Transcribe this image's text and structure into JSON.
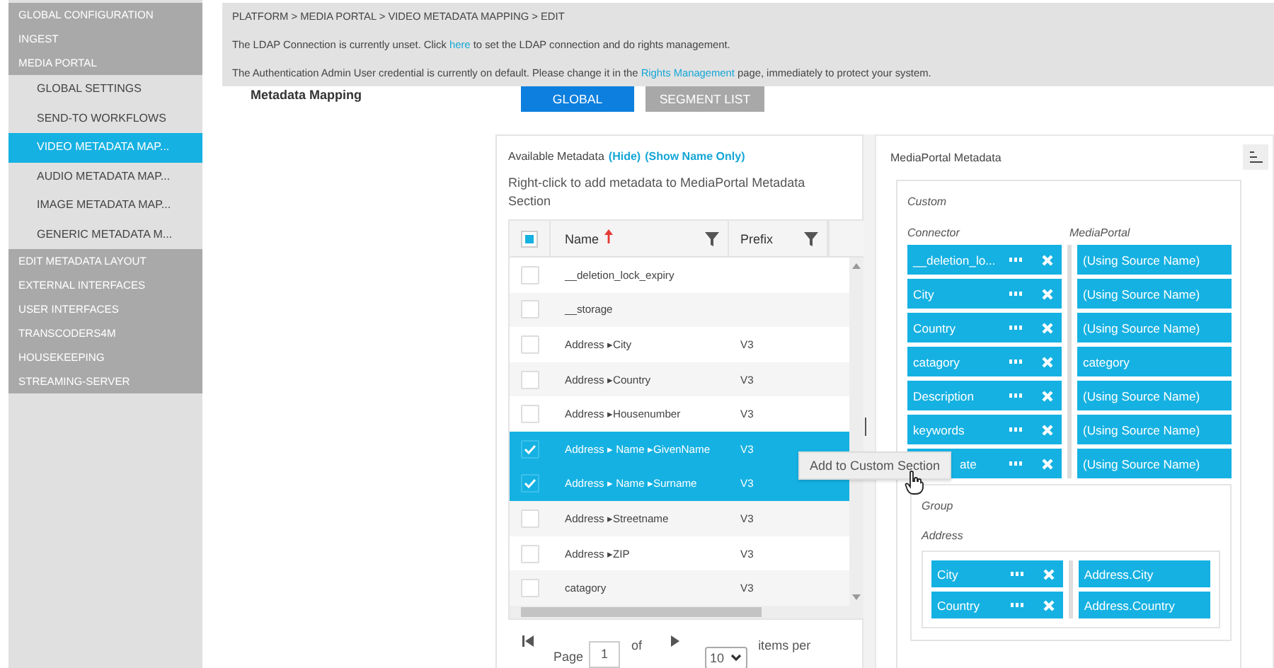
{
  "sidebar": {
    "items": [
      {
        "label": "GLOBAL CONFIGURATION",
        "selected": false
      },
      {
        "label": "INGEST",
        "selected": false
      },
      {
        "label": "MEDIA PORTAL",
        "selected": false,
        "children": [
          {
            "label": "GLOBAL SETTINGS",
            "selected": false
          },
          {
            "label": "SEND-TO WORKFLOWS",
            "selected": false
          },
          {
            "label": "VIDEO METADATA MAP...",
            "selected": true
          },
          {
            "label": "AUDIO METADATA MAP...",
            "selected": false
          },
          {
            "label": "IMAGE METADATA MAP...",
            "selected": false
          },
          {
            "label": "GENERIC METADATA M...",
            "selected": false
          }
        ]
      },
      {
        "label": "EDIT METADATA LAYOUT",
        "selected": false
      },
      {
        "label": "EXTERNAL INTERFACES",
        "selected": false
      },
      {
        "label": "USER INTERFACES",
        "selected": false
      },
      {
        "label": "TRANSCODERS4M",
        "selected": false
      },
      {
        "label": "HOUSEKEEPING",
        "selected": false
      },
      {
        "label": "STREAMING-SERVER",
        "selected": false
      }
    ]
  },
  "banner": {
    "breadcrumb": "PLATFORM > MEDIA PORTAL > VIDEO METADATA MAPPING > EDIT",
    "messages": [
      {
        "before": "The LDAP Connection is currently unset. Click ",
        "link": "here",
        "after": " to set the LDAP connection and do rights management."
      },
      {
        "before": "The Authentication Admin User credential is currently on default. Please change it in the ",
        "link": "Rights Management",
        "after": " page, immediately to protect your system."
      }
    ]
  },
  "page_title": "Metadata Mapping",
  "tabs": [
    {
      "label": "GLOBAL",
      "selected": true
    },
    {
      "label": "SEGMENT LIST",
      "selected": false
    }
  ],
  "available": {
    "title": "Available Metadata",
    "links": [
      "(Hide)",
      "(Show Name Only)"
    ],
    "hint": "Right-click to add metadata to MediaPortal Metadata Section",
    "select_all": {
      "partial": true
    },
    "columns": [
      {
        "label": "Name",
        "sorted": true
      },
      {
        "label": "Prefix",
        "sorted": false
      }
    ],
    "rows": [
      {
        "name": "__deletion_lock_expiry",
        "prefix": "",
        "checked": false
      },
      {
        "name": "__storage",
        "prefix": "",
        "checked": false
      },
      {
        "name": "Address ▸City",
        "prefix": "V3",
        "checked": false
      },
      {
        "name": "Address ▸Country",
        "prefix": "V3",
        "checked": false
      },
      {
        "name": "Address ▸Housenumber",
        "prefix": "V3",
        "checked": false
      },
      {
        "name": "Address ▸ Name ▸GivenName",
        "prefix": "V3",
        "checked": true
      },
      {
        "name": "Address ▸ Name ▸Surname",
        "prefix": "V3",
        "checked": true
      },
      {
        "name": "Address ▸Streetname",
        "prefix": "V3",
        "checked": false
      },
      {
        "name": "Address ▸ZIP",
        "prefix": "V3",
        "checked": false
      },
      {
        "name": "catagory",
        "prefix": "V3",
        "checked": false
      }
    ],
    "pagination": {
      "page_label": "Page",
      "page": "1",
      "of": "of",
      "per_page": "10",
      "per_label": "items per"
    }
  },
  "tooltip": "Add to Custom Section",
  "mediaportal": {
    "title": "MediaPortal Metadata",
    "custom": {
      "title": "Custom",
      "headers": [
        "Connector",
        "MediaPortal"
      ],
      "mappings": [
        {
          "connector": "__deletion_lo...",
          "target": "(Using Source Name)",
          "obscured": false
        },
        {
          "connector": "City",
          "target": "(Using Source Name)",
          "obscured": false
        },
        {
          "connector": "Country",
          "target": "(Using Source Name)",
          "obscured": false
        },
        {
          "connector": "catagory",
          "target": "category",
          "obscured": false
        },
        {
          "connector": "Description",
          "target": "(Using Source Name)",
          "obscured": false
        },
        {
          "connector": "keywords",
          "target": "(Using Source Name)",
          "obscured": false
        },
        {
          "connector": "ate",
          "target": "(Using Source Name)",
          "obscured": true
        }
      ]
    },
    "group": {
      "title": "Group",
      "name": "Address",
      "mappings": [
        {
          "connector": "City",
          "target": "Address.City"
        },
        {
          "connector": "Country",
          "target": "Address.Country"
        }
      ]
    }
  }
}
